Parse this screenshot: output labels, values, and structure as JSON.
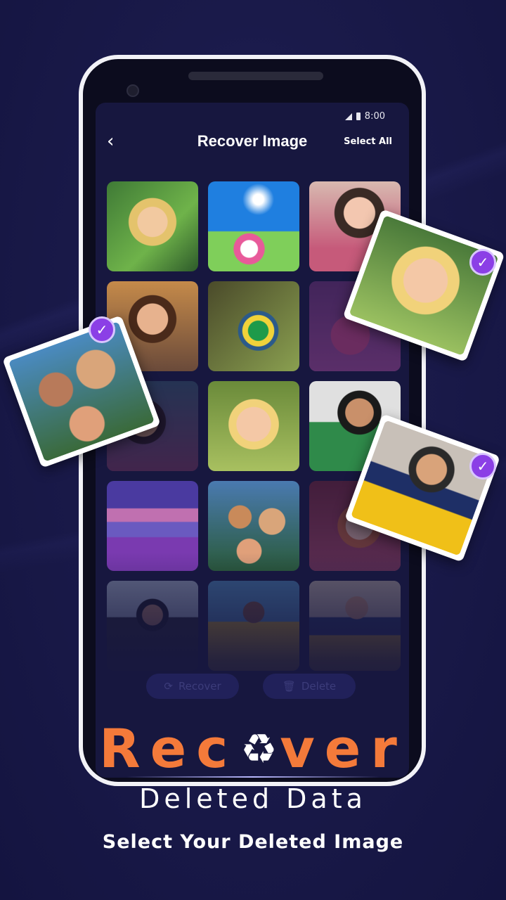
{
  "status_bar": {
    "time": "8:00"
  },
  "app_bar": {
    "title": "Recover Image",
    "select_all": "Select All",
    "back_icon": "chevron-left-icon"
  },
  "grid": {
    "items": [
      {
        "name": "photo-girl-hat"
      },
      {
        "name": "photo-daisy-sky"
      },
      {
        "name": "photo-girl-pink"
      },
      {
        "name": "photo-boy-sunglasses"
      },
      {
        "name": "photo-bird-branch"
      },
      {
        "name": "photo-pink-rose"
      },
      {
        "name": "photo-woman-portrait"
      },
      {
        "name": "photo-blonde-toddler"
      },
      {
        "name": "photo-man-sunglasses"
      },
      {
        "name": "photo-lake-sunset"
      },
      {
        "name": "photo-family-selfie"
      },
      {
        "name": "photo-girl-red"
      },
      {
        "name": "photo-man-standing"
      },
      {
        "name": "photo-woman-yellow"
      },
      {
        "name": "photo-man-yellow-coat"
      }
    ]
  },
  "actions": {
    "recover": "Recover",
    "delete": "Delete"
  },
  "selected_cards": [
    {
      "name": "selected-family-selfie"
    },
    {
      "name": "selected-blonde-toddler"
    },
    {
      "name": "selected-man-yellow-coat"
    }
  ],
  "promo": {
    "headline_start": "Rec",
    "headline_end": "ver",
    "subheadline": "Deleted Data",
    "tagline": "Select Your Deleted Image"
  },
  "colors": {
    "accent": "#f47a3a",
    "check": "#8b3fe6",
    "background": "#1a1a4a"
  }
}
